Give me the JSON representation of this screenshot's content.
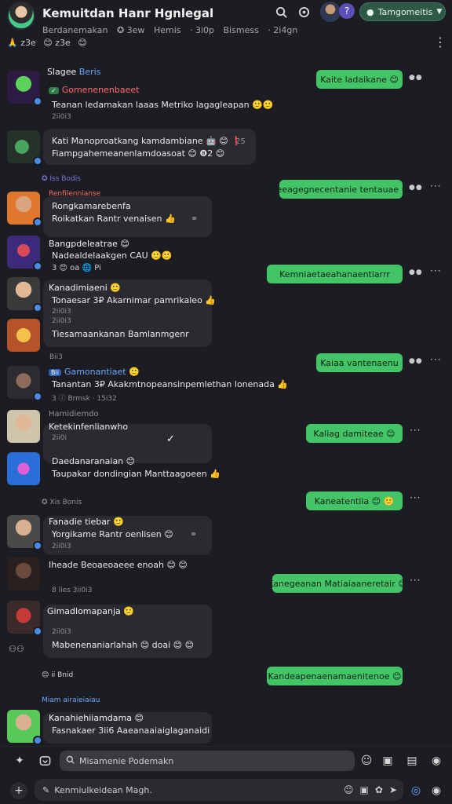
{
  "header": {
    "title": "Kemuitdan Hanr Hgnlegal",
    "sub": [
      "Berdanemakan",
      "✪ 3ew",
      "Hemis",
      "· 3i0p",
      "Bismess",
      "· 2i4gn"
    ],
    "reacts": [
      "🙏 z3e",
      "😊 z3e",
      "😊"
    ],
    "community_label": "Tamgomeitis",
    "colors": {
      "accent": "#43c466",
      "background": "#1c1d22",
      "bubble": "#2a2b31"
    }
  },
  "icons": {
    "search": "search-icon",
    "refresh": "refresh-icon",
    "help": "help-icon",
    "more": "more-vert-icon"
  },
  "messages": [
    {
      "name": "Slagee",
      "badge": "Beris",
      "tag": "Gomenenenbaeet",
      "text": "Teanan ledamakan laaas Metriko lagagleapan 🙂🙂",
      "meta": "2ii0i3"
    },
    {
      "lines": [
        "Kati Manoproatkang kamdambiane 🤖 😊 ❗",
        "Fiampgahemeanenlamdoasoat 😊 ❽2 😊"
      ],
      "tail": "25"
    },
    {
      "label": "✪ Iss Bodis"
    },
    {
      "name": "Renfilennianse",
      "lines": [
        "Rongkamarebenfa",
        "Roikatkan Rantr venaisen 👍"
      ]
    },
    {
      "name": "Bangpdeleatrae 😊",
      "lines": [
        "Nadealdelaakgen CAU 🙂🙂",
        "3 😊 oa 🌐 Pi"
      ]
    },
    {
      "name": "Kanadimiaeni 🙂",
      "lines": [
        "Tonaesar 3₽ Akarnimar pamrikaleo 👍",
        "2ii0i3",
        "2ii0i3"
      ]
    },
    {
      "text": "Tiesamaankanan Bamlanmgenr"
    },
    {
      "label": "Bii3"
    },
    {
      "name": "Gamonantiaet 🙂",
      "tag": "Bii",
      "text": "Tanantan 3₽ Akakmtnopeansinpemlethan lonenada 👍",
      "meta": "3 ⓘ Brmsk · 15i32"
    },
    {
      "name": "Hamidiemdo",
      "lines": [
        "Hamidiemdo",
        "Ketekinfenlianwho",
        "2ii0i"
      ]
    },
    {
      "lines": [
        "Daedanaranaian 😊",
        "Taupakar dondingian Manttaagoeen 👍"
      ]
    },
    {
      "label": "✪ Xis Bonis"
    },
    {
      "name": "Fanadie tiebar 🙂",
      "lines": [
        "Yorgikame Rantr oenlisen 😊",
        "2ii0i3"
      ]
    },
    {
      "lines": [
        "Iheade Beoaeoaeee enoah 😊 😊",
        "8 lies 3ii0i3"
      ]
    },
    {
      "name": "Gimadlomapanja 🙂",
      "lines": [
        "2ii0i3",
        "Mabenenaniarlahah 😊 doai 😊 😊"
      ]
    },
    {
      "label": "😊 ii Bnid"
    },
    {
      "label": "Miam airaieiaiau"
    },
    {
      "name": "Kanahiehiiamdama 😊",
      "lines": [
        "Fasnakaer 3ii6 Aaeanaaiaiglaganaidi"
      ]
    }
  ],
  "outgoing": [
    "Kaite ladaikane 😊",
    "Keeagegnecentanie tentauae 😊",
    "Kemniaetaeahanaentiarrr",
    "Kaiaa vantenaenu",
    "Kaliag damiteae 😊",
    "Kaneatentiia 😊 🙂",
    "Kanegeanan Matiaiaaneretair 😊",
    "Kandeapenaenamaenitenoe 😊"
  ],
  "composer": {
    "search_placeholder": "Misamenie Podemakn",
    "message_placeholder": "Kenmiulkeidean Magh."
  }
}
